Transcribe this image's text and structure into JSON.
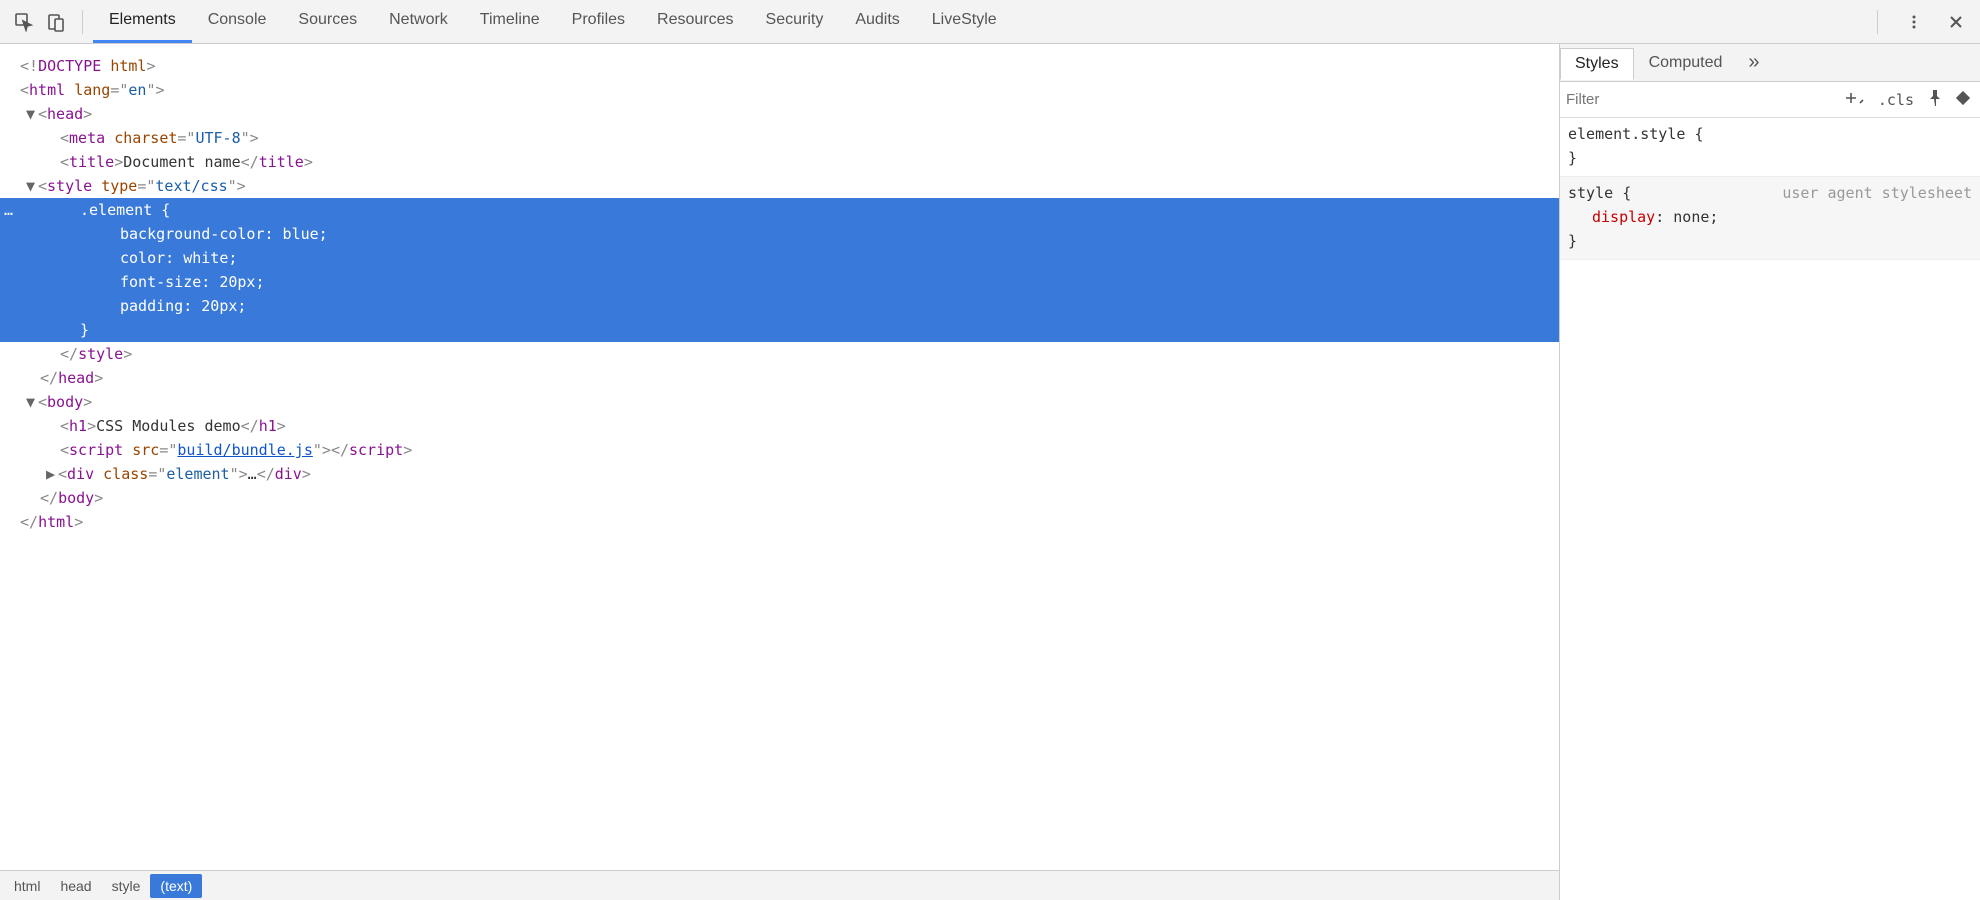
{
  "toolbar": {
    "tabs": [
      "Elements",
      "Console",
      "Sources",
      "Network",
      "Timeline",
      "Profiles",
      "Resources",
      "Security",
      "Audits",
      "LiveStyle"
    ],
    "active_tab": 0
  },
  "dom": {
    "lines": [
      {
        "indent": 0,
        "arrow": "",
        "html": [
          [
            "punc",
            "<!"
          ],
          [
            "tag",
            "DOCTYPE "
          ],
          [
            "attr",
            "html"
          ],
          [
            "punc",
            ">"
          ]
        ]
      },
      {
        "indent": 0,
        "arrow": "",
        "html": [
          [
            "punc",
            "<"
          ],
          [
            "tag",
            "html "
          ],
          [
            "attr",
            "lang"
          ],
          [
            "punc",
            "=\""
          ],
          [
            "val",
            "en"
          ],
          [
            "punc",
            "\">"
          ]
        ]
      },
      {
        "indent": 1,
        "arrow": "▼",
        "html": [
          [
            "punc",
            "<"
          ],
          [
            "tag",
            "head"
          ],
          [
            "punc",
            ">"
          ]
        ]
      },
      {
        "indent": 2,
        "arrow": "",
        "html": [
          [
            "punc",
            "<"
          ],
          [
            "tag",
            "meta "
          ],
          [
            "attr",
            "charset"
          ],
          [
            "punc",
            "=\""
          ],
          [
            "val",
            "UTF-8"
          ],
          [
            "punc",
            "\">"
          ]
        ]
      },
      {
        "indent": 2,
        "arrow": "",
        "html": [
          [
            "punc",
            "<"
          ],
          [
            "tag",
            "title"
          ],
          [
            "punc",
            ">"
          ],
          [
            "txt",
            "Document name"
          ],
          [
            "punc",
            "</"
          ],
          [
            "tag",
            "title"
          ],
          [
            "punc",
            ">"
          ]
        ]
      },
      {
        "indent": 1,
        "arrow": "▼",
        "html": [
          [
            "punc",
            "<"
          ],
          [
            "tag",
            "style "
          ],
          [
            "attr",
            "type"
          ],
          [
            "punc",
            "=\""
          ],
          [
            "val",
            "text/css"
          ],
          [
            "punc",
            "\">"
          ]
        ]
      },
      {
        "indent": 3,
        "arrow": "",
        "sel": true,
        "gutter": "…",
        "html": [
          [
            "txt",
            ".element {"
          ]
        ]
      },
      {
        "indent": 5,
        "arrow": "",
        "sel": true,
        "html": [
          [
            "txt",
            "background-color: blue;"
          ]
        ]
      },
      {
        "indent": 5,
        "arrow": "",
        "sel": true,
        "html": [
          [
            "txt",
            "color: white;"
          ]
        ]
      },
      {
        "indent": 5,
        "arrow": "",
        "sel": true,
        "html": [
          [
            "txt",
            "font-size: 20px;"
          ]
        ]
      },
      {
        "indent": 5,
        "arrow": "",
        "sel": true,
        "html": [
          [
            "txt",
            "padding: 20px;"
          ]
        ]
      },
      {
        "indent": 3,
        "arrow": "",
        "sel": true,
        "html": [
          [
            "txt",
            "}"
          ]
        ]
      },
      {
        "indent": 2,
        "arrow": "",
        "html": [
          [
            "punc",
            "</"
          ],
          [
            "tag",
            "style"
          ],
          [
            "punc",
            ">"
          ]
        ]
      },
      {
        "indent": 1,
        "arrow": "",
        "html": [
          [
            "punc",
            "</"
          ],
          [
            "tag",
            "head"
          ],
          [
            "punc",
            ">"
          ]
        ]
      },
      {
        "indent": 1,
        "arrow": "▼",
        "html": [
          [
            "punc",
            "<"
          ],
          [
            "tag",
            "body"
          ],
          [
            "punc",
            ">"
          ]
        ]
      },
      {
        "indent": 2,
        "arrow": "",
        "html": [
          [
            "punc",
            "<"
          ],
          [
            "tag",
            "h1"
          ],
          [
            "punc",
            ">"
          ],
          [
            "txt",
            "CSS Modules demo"
          ],
          [
            "punc",
            "</"
          ],
          [
            "tag",
            "h1"
          ],
          [
            "punc",
            ">"
          ]
        ]
      },
      {
        "indent": 2,
        "arrow": "",
        "html": [
          [
            "punc",
            "<"
          ],
          [
            "tag",
            "script "
          ],
          [
            "attr",
            "src"
          ],
          [
            "punc",
            "=\""
          ],
          [
            "link",
            "build/bundle.js"
          ],
          [
            "punc",
            "\">"
          ],
          [
            "punc",
            "</"
          ],
          [
            "tag",
            "script"
          ],
          [
            "punc",
            ">"
          ]
        ]
      },
      {
        "indent": 2,
        "arrow": "▶",
        "html": [
          [
            "punc",
            "<"
          ],
          [
            "tag",
            "div "
          ],
          [
            "attr",
            "class"
          ],
          [
            "punc",
            "=\""
          ],
          [
            "val",
            "element"
          ],
          [
            "punc",
            "\">"
          ],
          [
            "txt",
            "…"
          ],
          [
            "punc",
            "</"
          ],
          [
            "tag",
            "div"
          ],
          [
            "punc",
            ">"
          ]
        ]
      },
      {
        "indent": 1,
        "arrow": "",
        "html": [
          [
            "punc",
            "</"
          ],
          [
            "tag",
            "body"
          ],
          [
            "punc",
            ">"
          ]
        ]
      },
      {
        "indent": 0,
        "arrow": "",
        "html": [
          [
            "punc",
            "</"
          ],
          [
            "tag",
            "html"
          ],
          [
            "punc",
            ">"
          ]
        ]
      }
    ]
  },
  "crumbs": {
    "items": [
      "html",
      "head",
      "style",
      "(text)"
    ],
    "active": 3
  },
  "sidebar": {
    "tabs": [
      "Styles",
      "Computed"
    ],
    "active": 0,
    "more_glyph": "»",
    "filter_placeholder": "Filter",
    "cls_label": ".cls",
    "rules": [
      {
        "selector": "element.style",
        "open": "{",
        "close": "}",
        "props": [],
        "ua": false
      },
      {
        "selector": "style",
        "open": "{",
        "close": "}",
        "ua": true,
        "ua_label": "user agent stylesheet",
        "props": [
          {
            "name": "display",
            "value": "none;"
          }
        ]
      }
    ]
  }
}
